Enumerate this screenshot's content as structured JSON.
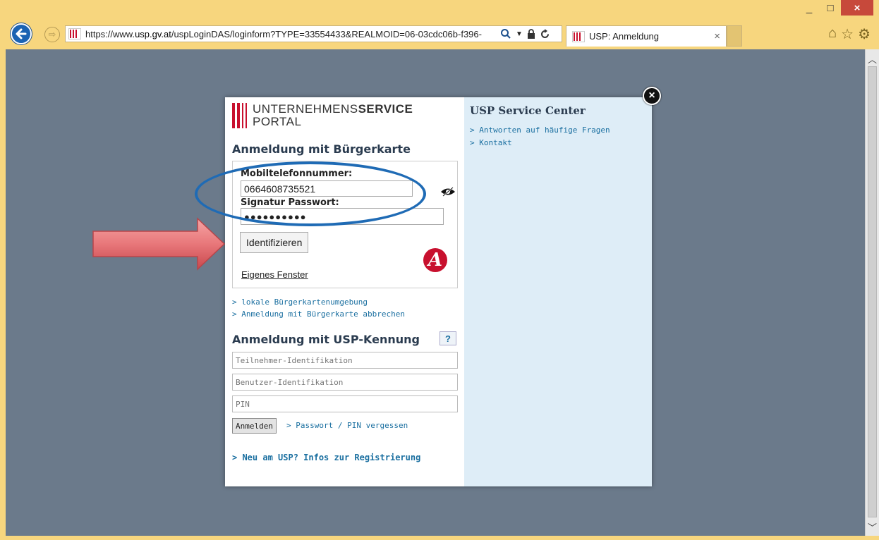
{
  "browser": {
    "url_prefix": "https://www.",
    "url_domain": "usp.gv.at",
    "url_path": "/uspLoginDAS/loginform?TYPE=33554433&REALMOID=06-03cdc06b-f396-",
    "tab_title": "USP: Anmeldung",
    "tab_close": "×",
    "window_min": "_",
    "window_max": "□",
    "window_close": "×"
  },
  "modal": {
    "close": "×",
    "logo": {
      "line1_a": "UNTERNEHMENS",
      "line1_b": "SERVICE",
      "line2": "PORTAL"
    },
    "buergerkarte": {
      "heading": "Anmeldung mit Bürgerkarte",
      "phone_label": "Mobiltelefonnummer:",
      "phone_value": "0664608735521",
      "password_label": "Signatur Passwort:",
      "password_value": "●●●●●●●●●●",
      "identify_button": "Identifizieren",
      "own_window": "Eigenes Fenster",
      "a_logo": "A"
    },
    "links": {
      "local_env": "> lokale Bürgerkartenumgebung",
      "cancel_bk": "> Anmeldung mit Bürgerkarte abbrechen"
    },
    "usp": {
      "heading": "Anmeldung mit USP-Kennung",
      "help": "?",
      "participant_placeholder": "Teilnehmer-Identifikation",
      "user_placeholder": "Benutzer-Identifikation",
      "pin_placeholder": "PIN",
      "login_button": "Anmelden",
      "forgot": "> Passwort / PIN vergessen",
      "register": ">  Neu am USP? Infos zur Registrierung"
    },
    "service_center": {
      "title": "USP Service Center",
      "faq": "> Antworten auf häufige Fragen",
      "contact": "> Kontakt"
    }
  },
  "colors": {
    "chrome_bg": "#f7d67e",
    "page_bg": "#6b7a8b",
    "accent_red": "#c8102e",
    "link_blue": "#1a6fa0",
    "panel_blue": "#deedf7",
    "annotation_blue": "#1f6bb5",
    "arrow_red": "#e8777a"
  }
}
